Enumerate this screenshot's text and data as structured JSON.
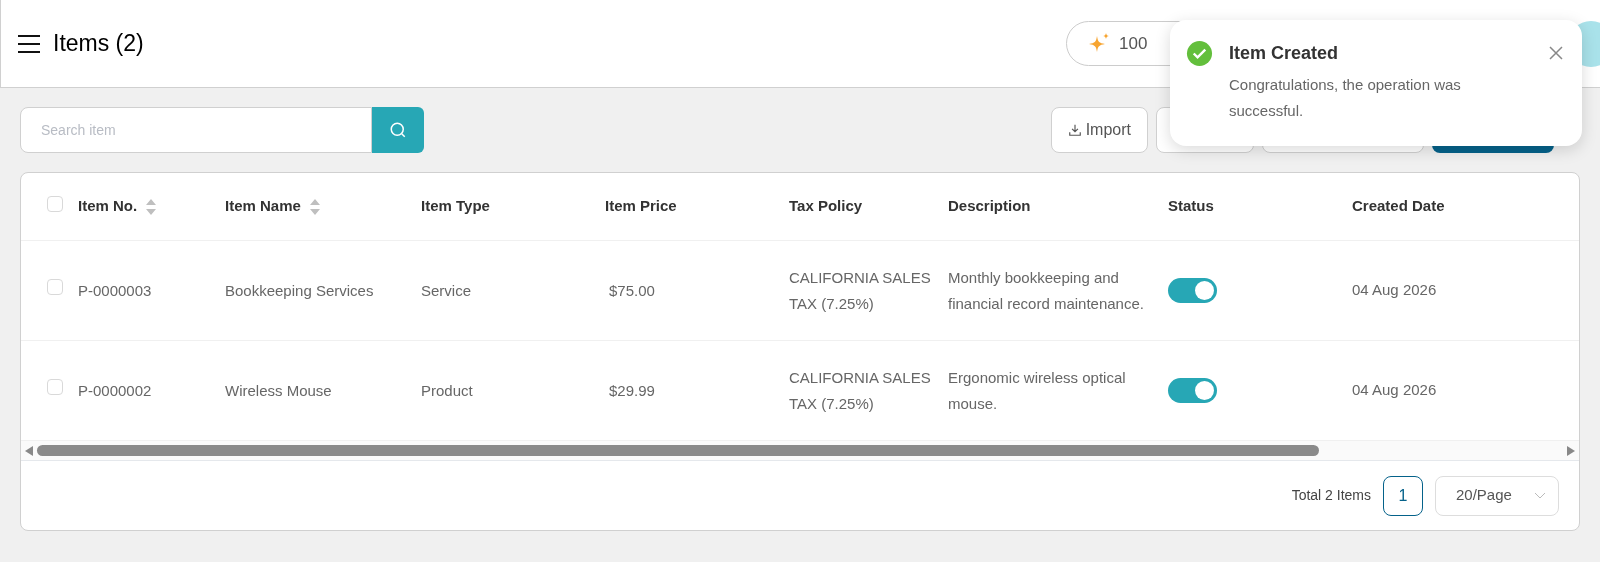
{
  "header": {
    "title": "Items (2)",
    "credits": "100"
  },
  "search": {
    "placeholder": "Search item"
  },
  "toolbar": {
    "import": "Import"
  },
  "table": {
    "all_checked": false,
    "columns": [
      {
        "label": "Item No.",
        "sortable": true
      },
      {
        "label": "Item Name",
        "sortable": true
      },
      {
        "label": "Item Type",
        "sortable": false
      },
      {
        "label": "Item Price",
        "sortable": false
      },
      {
        "label": "Tax Policy",
        "sortable": false
      },
      {
        "label": "Description",
        "sortable": false
      },
      {
        "label": "Status",
        "sortable": false
      },
      {
        "label": "Created Date",
        "sortable": false
      }
    ],
    "rows": [
      {
        "checked": false,
        "cells": [
          "P-0000003",
          "Bookkeeping Services",
          "Service",
          "$75.00",
          "CALIFORNIA SALES TAX (7.25%)",
          "Monthly bookkeeping and financial record maintenance."
        ],
        "on": true,
        "date": "04 Aug 2026"
      },
      {
        "checked": false,
        "cells": [
          "P-0000002",
          "Wireless Mouse",
          "Product",
          "$29.99",
          "CALIFORNIA SALES TAX (7.25%)",
          "Ergonomic wireless optical mouse."
        ],
        "on": true,
        "date": "04 Aug 2026"
      }
    ]
  },
  "pagination": {
    "total": "Total 2 Items",
    "pages": [
      {
        "label": "1",
        "selected": true
      }
    ],
    "page_size": "20/Page"
  },
  "toast": {
    "title": "Item Created",
    "message": "Congratulations, the operation was successful."
  }
}
